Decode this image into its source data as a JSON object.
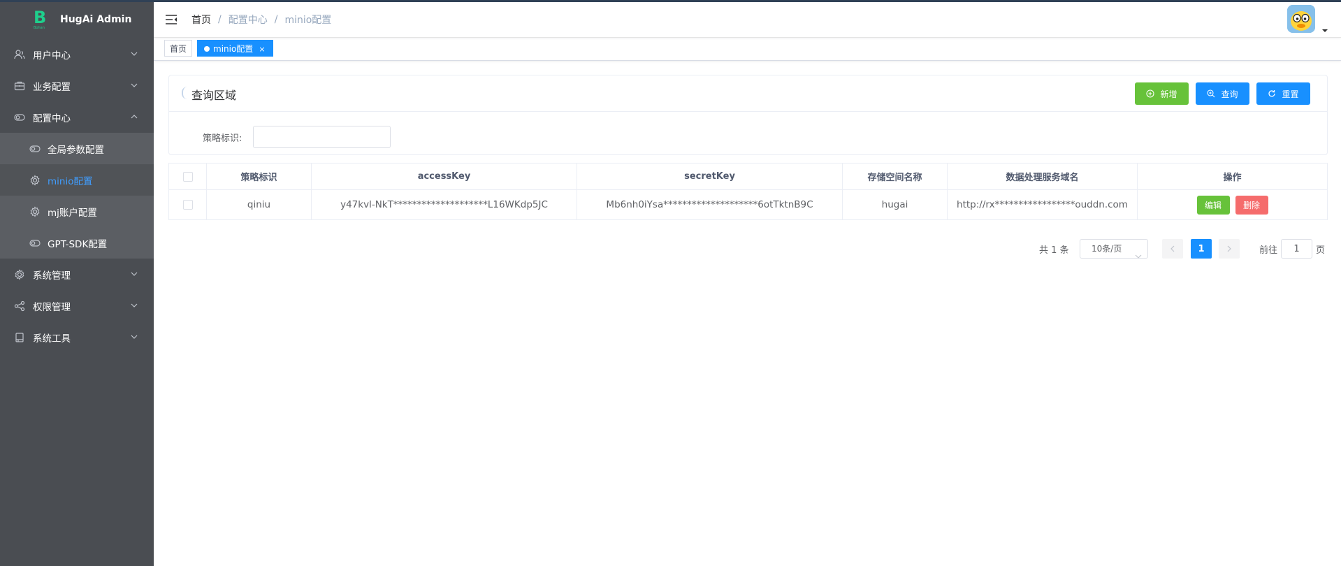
{
  "app": {
    "title": "HugAi Admin",
    "logo_letter": "B",
    "logo_sub": "Bohan"
  },
  "sidebar": {
    "items": [
      {
        "label": "用户中心",
        "icon": "user-icon"
      },
      {
        "label": "业务配置",
        "icon": "briefcase-icon"
      },
      {
        "label": "配置中心",
        "icon": "toggle-icon",
        "expanded": true
      },
      {
        "label": "系统管理",
        "icon": "gear-icon"
      },
      {
        "label": "权限管理",
        "icon": "share-icon"
      },
      {
        "label": "系统工具",
        "icon": "tool-icon"
      }
    ],
    "subitems": [
      {
        "label": "全局参数配置",
        "icon": "toggle-icon"
      },
      {
        "label": "minio配置",
        "icon": "gear-icon",
        "active": true
      },
      {
        "label": "mj账户配置",
        "icon": "gear-icon"
      },
      {
        "label": "GPT-SDK配置",
        "icon": "toggle-icon"
      }
    ]
  },
  "breadcrumb": [
    "首页",
    "配置中心",
    "minio配置"
  ],
  "tags": [
    "首页",
    "minio配置"
  ],
  "query": {
    "title": "查询区域",
    "buttons": {
      "add": "新增",
      "search": "查询",
      "reset": "重置"
    },
    "field_label": "策略标识:",
    "field_value": ""
  },
  "table": {
    "headers": [
      "策略标识",
      "accessKey",
      "secretKey",
      "存储空间名称",
      "数据处理服务域名",
      "操作"
    ],
    "rows": [
      [
        "qiniu",
        "y47kvl-NkT********************L16WKdp5JC",
        "Mb6nh0iYsa********************6otTktnB9C",
        "hugai",
        "http://rx*****************ouddn.com"
      ]
    ],
    "actions": {
      "edit": "编辑",
      "delete": "删除"
    }
  },
  "pagination": {
    "total": "共 1 条",
    "page_size": "10条/页",
    "current": "1",
    "goto_label": "前往",
    "goto_value": "1",
    "goto_unit": "页"
  },
  "colors": {
    "sidebar": "#4a4d52",
    "primary": "#1890ff",
    "success": "#67c23a",
    "danger": "#f56c6c"
  }
}
